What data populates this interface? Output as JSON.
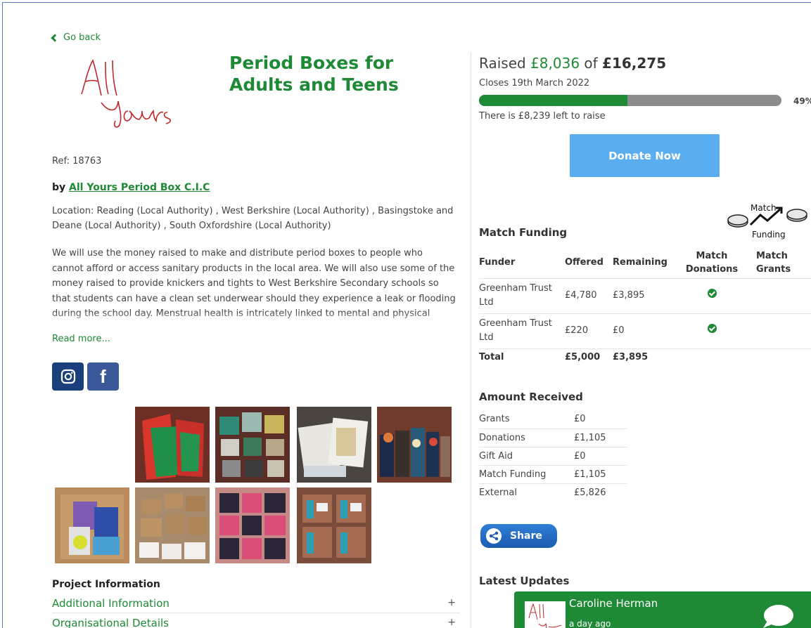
{
  "nav": {
    "go_back": "Go back"
  },
  "project": {
    "title": "Period Boxes for Adults and Teens",
    "ref": "Ref: 18763",
    "by_prefix": "by",
    "organisation": "All Yours Period Box C.I.C",
    "location": "Location: Reading (Local Authority) , West Berkshire (Local Authority) , Basingstoke and Deane (Local Authority) , South Oxfordshire (Local Authority)",
    "description": "We will use the money raised to make and distribute period boxes to people who cannot afford or access sanitary products in the local area. We will also use some of the money raised to provide knickers and tights to West Berkshire Secondary schools so that students can have a clean set underwear should they experience a leak or flooding during the school day. Menstrual health is intricately linked to mental and physical",
    "read_more": "Read more...",
    "logo_text_line1": "All",
    "logo_text_line2": "Yours"
  },
  "social": {
    "instagram": "instagram-icon",
    "facebook": "f"
  },
  "gallery": {
    "count": 8
  },
  "project_info": {
    "heading": "Project Information",
    "items": [
      {
        "label": "Additional Information",
        "toggle": "+"
      },
      {
        "label": "Organisational Details",
        "toggle": "+"
      }
    ]
  },
  "funding": {
    "raised_prefix": "Raised",
    "raised": "£8,036",
    "of": "of",
    "target": "£16,275",
    "closes": "Closes 19th March 2022",
    "progress_fraction": 0.49,
    "percent_label": "49%",
    "left_to_raise": "There is £8,239 left to raise",
    "donate_label": "Donate Now"
  },
  "match_funding": {
    "heading": "Match Funding",
    "logo_top": "Match",
    "logo_bottom": "Funding",
    "columns": [
      "Funder",
      "Offered",
      "Remaining",
      "Match Donations",
      "Match Grants"
    ],
    "rows": [
      {
        "funder": "Greenham Trust Ltd",
        "offered": "£4,780",
        "remaining": "£3,895",
        "match_donations": true,
        "match_grants": false
      },
      {
        "funder": "Greenham Trust Ltd",
        "offered": "£220",
        "remaining": "£0",
        "match_donations": true,
        "match_grants": false
      }
    ],
    "total": {
      "label": "Total",
      "offered": "£5,000",
      "remaining": "£3,895"
    }
  },
  "amount_received": {
    "heading": "Amount Received",
    "rows": [
      {
        "label": "Grants",
        "value": "£0"
      },
      {
        "label": "Donations",
        "value": "£1,105"
      },
      {
        "label": "Gift Aid",
        "value": "£0"
      },
      {
        "label": "Match Funding",
        "value": "£1,105"
      },
      {
        "label": "External",
        "value": "£5,826"
      }
    ]
  },
  "share": {
    "label": "Share"
  },
  "updates": {
    "heading": "Latest Updates",
    "items": [
      {
        "author": "Caroline Herman",
        "time": "a day ago"
      }
    ]
  },
  "colors": {
    "brand_green": "#1e8a35",
    "donate_blue": "#5aaef0",
    "progress_grey": "#8c8c8c"
  }
}
